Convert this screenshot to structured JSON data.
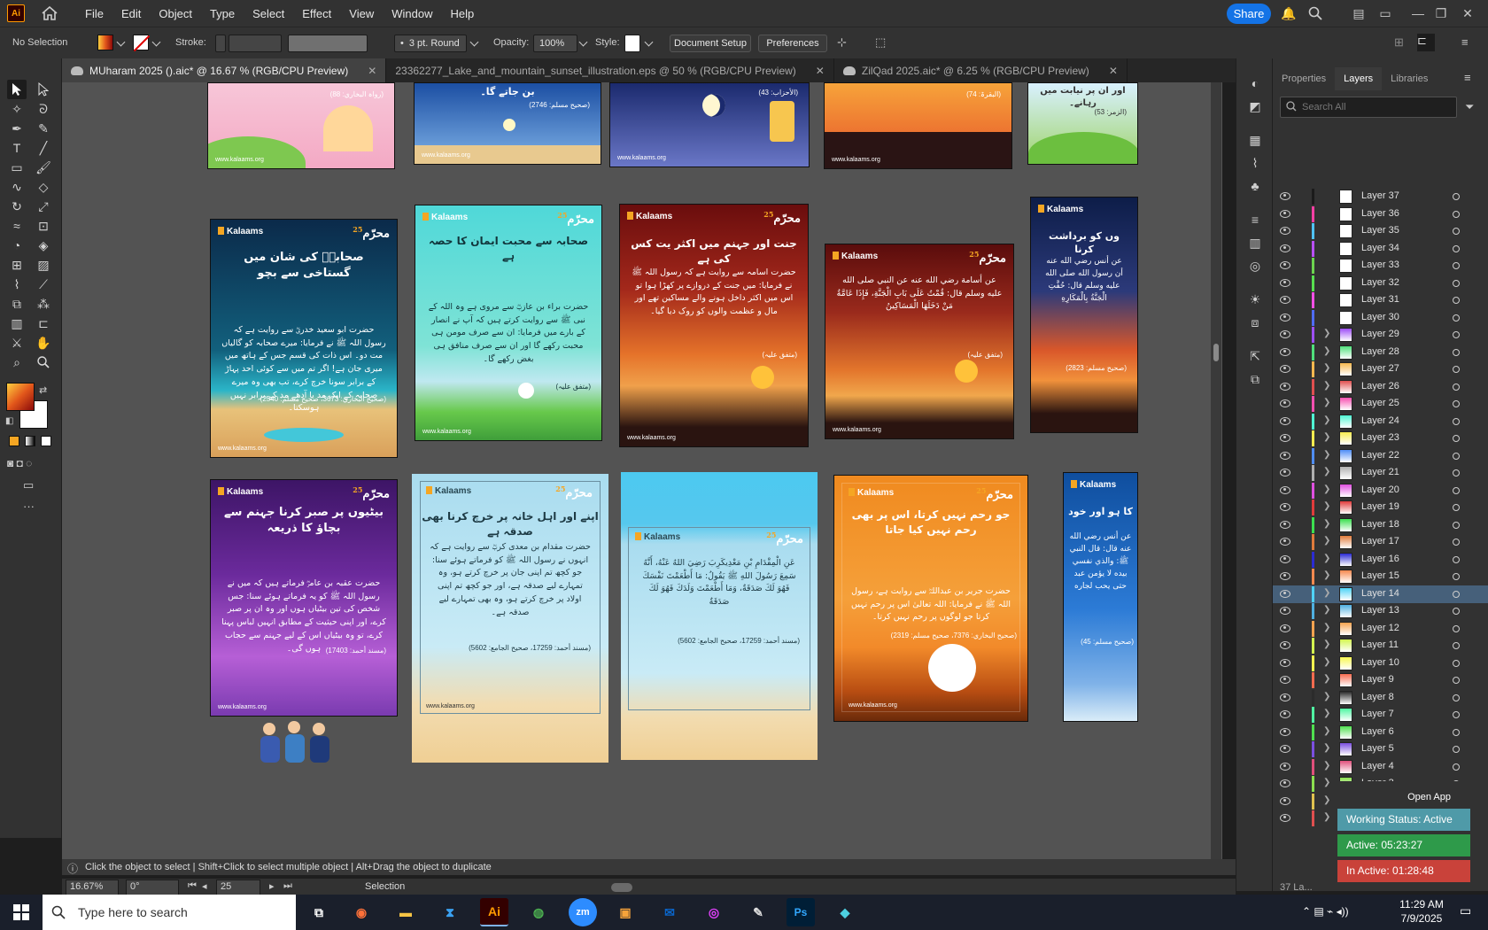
{
  "app": {
    "logo": "Ai",
    "menu": [
      "File",
      "Edit",
      "Object",
      "Type",
      "Select",
      "Effect",
      "View",
      "Window",
      "Help"
    ],
    "share_label": "Share"
  },
  "control_bar": {
    "selection_status": "No Selection",
    "stroke_label": "Stroke:",
    "brush": "3 pt. Round",
    "opacity_label": "Opacity:",
    "opacity_value": "100%",
    "style_label": "Style:",
    "document_setup": "Document Setup",
    "preferences": "Preferences"
  },
  "tabs": [
    {
      "label": "MUharam 2025 ().aic* @ 16.67 % (RGB/CPU Preview)",
      "active": true
    },
    {
      "label": "23362277_Lake_and_mountain_sunset_illustration.eps @ 50 % (RGB/CPU Preview)",
      "active": false
    },
    {
      "label": "ZilQad 2025.aic* @ 6.25 % (RGB/CPU Preview)",
      "active": false
    }
  ],
  "artboards_row2": [
    {
      "title": "صحابہؓ کی شان میں گستاخی سے بچو",
      "body": "حضرت ابو سعید خدریؓ سے روایت ہے کہ رسول اللہ ﷺ نے فرمایا: میرے صحابہ کو گالیاں مت دو۔ اس ذات کی قسم جس کے ہاتھ میں میری جان ہے! اگر تم میں سے کوئی احد پہاڑ کے برابر سونا خرچ کرے، تب بھی وہ میرے صحابہ کے ایک مد یا آدھے مد کے برابر نہیں ہوسکتا۔",
      "ref": "(صحیح البخاري: 3673، صحیح مسلم: 2540)"
    },
    {
      "title": "صحابہ سے محبت ایمان کا حصہ ہے",
      "body": "حضرت براء بن عازبؓ سے مروی ہے وہ اللہ کے نبی ﷺ سے روایت کرتے ہیں کہ آپ نے انصار کے بارے میں فرمایا: ان سے صرف مومن ہی محبت رکھے گا اور ان سے صرف منافق ہی بغض رکھے گا۔",
      "ref": "(متفق علیہ)"
    },
    {
      "title": "جنت اور جہنم میں اکثر یت کس کی ہے",
      "body": "حضرت اسامہ سے روایت ہے کہ رسول اللہ ﷺ نے فرمایا: میں جنت کے دروازے پر کھڑا ہوا تو اس میں اکثر داخل ہونے والے مساکین تھے اور مال و عظمت والوں کو روک دیا گیا۔",
      "ref": "(متفق علیہ)"
    },
    {
      "title": "",
      "body": "عن أسامة رضي الله عنه عن النبي صلى الله عليه وسلم قال: قُمْتُ عَلَى بَابِ الْجَنَّةِ، فَإِذَا عَامَّةُ مَنْ دَخَلَهَا الْمَسَاكِينُ",
      "ref": "(متفق علیہ)"
    },
    {
      "title": "وں کو برداشت کرنا",
      "body": "عن أنس رضي الله عنه أن رسول الله صلى الله عليه وسلم قال: حُفَّتِ الْجَنَّةُ بِالْمَكَارِهِ",
      "ref": "(صحیح مسلم: 2823)"
    }
  ],
  "artboards_row3": [
    {
      "title": "بیٹیوں پر صبر کرنا جہنم سے بچاؤ کا ذریعہ",
      "body": "حضرت عقبہ بن عامرؓ فرماتے ہیں کہ میں نے رسول اللہ ﷺ کو یہ فرماتے ہوئے سنا: جس شخص کی تین بیٹیاں ہوں اور وہ ان پر صبر کرے، اور اپنی حیثیت کے مطابق انہیں لباس پہنا کرے، تو وہ بیٹیاں اس کے لیے جہنم سے حجاب ہوں گی۔",
      "ref": "(مسند أحمد: 17403)"
    },
    {
      "title": "اپنے اور اہل خانہ پر خرچ کرنا بھی صدقہ ہے",
      "body": "حضرت مقدام بن معدی کربؓ سے روایت ہے کہ انہوں نے رسول اللہ ﷺ کو فرماتے ہوئے سنا: جو کچھ تم اپنی جان پر خرچ کرتے ہو، وہ تمہارے لیے صدقہ ہے، اور جو کچھ تم اپنی اولاد پر خرچ کرتے ہو، وہ بھی تمہارے لیے صدقہ ہے۔",
      "ref": "(مسند أحمد: 17259، صحیح الجامع: 5602)"
    },
    {
      "title": "",
      "body": "عَنِ الْمِقْدَامِ بْنِ مَعْدِيكَرِبَ رَضِيَ اللهُ عَنْهُ، أَنَّهُ سَمِعَ رَسُولَ اللهِ ﷺ يَقُولُ: مَا أَطْعَمْتَ نَفْسَكَ فَهُوَ لَكَ صَدَقَةٌ، وَمَا أَطْعَمْتَ وَلَدَكَ فَهُوَ لَكَ صَدَقَةٌ",
      "ref": "(مسند أحمد: 17259، صحیح الجامع: 5602)"
    },
    {
      "title": "جو رحم نہیں کرتا، اس پر بھی رحم نہیں کیا جاتا",
      "body": "حضرت جریر بن عبداللہؓ سے روایت ہے، رسول اللہ ﷺ نے فرمایا: اللہ تعالیٰ اس پر رحم نہیں کرتا جو لوگوں پر رحم نہیں کرتا۔",
      "ref": "(صحیح البخاري: 7376، صحیح مسلم: 2319)"
    },
    {
      "title": "کا ہو اور خود",
      "body": "عن أنس رضي الله عنه قال: قال النبي ﷺ: والذي نفسي بيده لا يؤمن عبد حتى يحب لجاره",
      "ref": "(صحیح مسلم: 45)"
    }
  ],
  "artboard_brand": "Kalaams",
  "artboard_badge": "محرّم",
  "artboard_badge_num": "25",
  "artboard_footer": "www.kalaams.org",
  "top_refs": [
    "(رواہ البخاري: 88)",
    "(صحیح مسلم: 2746)",
    "(الأحزاب: 43)",
    "(البقرۃ: 74)",
    "(الزمر: 53)"
  ],
  "top_text": [
    "بن جاتے گا۔",
    "اور ان پر نیابت میں رہانے۔"
  ],
  "panel": {
    "tabs": [
      "Properties",
      "Layers",
      "Libraries"
    ],
    "active_tab": "Layers",
    "search_placeholder": "Search All",
    "layers": [
      {
        "name": "Layer 37",
        "color": "#1b1b1b",
        "expandable": false
      },
      {
        "name": "Layer 36",
        "color": "#ff3fa4",
        "expandable": false
      },
      {
        "name": "Layer 35",
        "color": "#4fc3f7",
        "expandable": false
      },
      {
        "name": "Layer 34",
        "color": "#b84ff7",
        "expandable": false
      },
      {
        "name": "Layer 33",
        "color": "#6cd34f",
        "expandable": false
      },
      {
        "name": "Layer 32",
        "color": "#58e04f",
        "expandable": false
      },
      {
        "name": "Layer 31",
        "color": "#f74fe6",
        "expandable": false
      },
      {
        "name": "Layer 30",
        "color": "#4f6cf7",
        "expandable": false
      },
      {
        "name": "Layer 29",
        "color": "#9e4ff7",
        "expandable": true
      },
      {
        "name": "Layer 28",
        "color": "#4fe07b",
        "expandable": true
      },
      {
        "name": "Layer 27",
        "color": "#f7b84f",
        "expandable": true
      },
      {
        "name": "Layer 26",
        "color": "#e04f4f",
        "expandable": true
      },
      {
        "name": "Layer 25",
        "color": "#f74fb0",
        "expandable": true
      },
      {
        "name": "Layer 24",
        "color": "#4ff7d3",
        "expandable": true
      },
      {
        "name": "Layer 23",
        "color": "#f7ec4f",
        "expandable": true
      },
      {
        "name": "Layer 22",
        "color": "#4f8ef7",
        "expandable": true
      },
      {
        "name": "Layer 21",
        "color": "#b0b0b0",
        "expandable": true
      },
      {
        "name": "Layer 20",
        "color": "#e04fe0",
        "expandable": true
      },
      {
        "name": "Layer 19",
        "color": "#e03b3b",
        "expandable": true
      },
      {
        "name": "Layer 18",
        "color": "#3be04f",
        "expandable": true
      },
      {
        "name": "Layer 17",
        "color": "#e07b3b",
        "expandable": true
      },
      {
        "name": "Layer 16",
        "color": "#2b2bd3",
        "expandable": true
      },
      {
        "name": "Layer 15",
        "color": "#f7894f",
        "expandable": true
      },
      {
        "name": "Layer 14",
        "color": "#4fd3f7",
        "expandable": true,
        "selected": true
      },
      {
        "name": "Layer 13",
        "color": "#4fb0e0",
        "expandable": true
      },
      {
        "name": "Layer 12",
        "color": "#f7a34f",
        "expandable": true
      },
      {
        "name": "Layer 11",
        "color": "#d3f74f",
        "expandable": true
      },
      {
        "name": "Layer 10",
        "color": "#f7f74f",
        "expandable": true
      },
      {
        "name": "Layer 9",
        "color": "#f76b4f",
        "expandable": true
      },
      {
        "name": "Layer 8",
        "color": "#2b2b2b",
        "expandable": true
      },
      {
        "name": "Layer 7",
        "color": "#4ff7a3",
        "expandable": true
      },
      {
        "name": "Layer 6",
        "color": "#4fe04f",
        "expandable": true
      },
      {
        "name": "Layer 5",
        "color": "#7b4fe0",
        "expandable": true
      },
      {
        "name": "Layer 4",
        "color": "#e04f7b",
        "expandable": true
      },
      {
        "name": "Layer 3",
        "color": "#8be04f",
        "expandable": true
      },
      {
        "name": "Layer 2",
        "color": "#e0c24f",
        "expandable": true
      },
      {
        "name": "Layer 1",
        "color": "#e04f4f",
        "expandable": true
      }
    ],
    "footer_count": "37 La..."
  },
  "widget": {
    "open_app": "Open App",
    "working_status": "Working Status: Active",
    "active": "Active: 05:23:27",
    "inactive": "In Active: 01:28:48"
  },
  "hint_bar": "Click the object to select  |  Shift+Click to select multiple object  |  Alt+Drag the object to duplicate",
  "status": {
    "zoom": "16.67%",
    "rotation": "0°",
    "artboard_num": "25",
    "tool": "Selection"
  },
  "taskbar": {
    "search_placeholder": "Type here to search",
    "time": "11:29 AM",
    "date": "7/9/2025"
  }
}
